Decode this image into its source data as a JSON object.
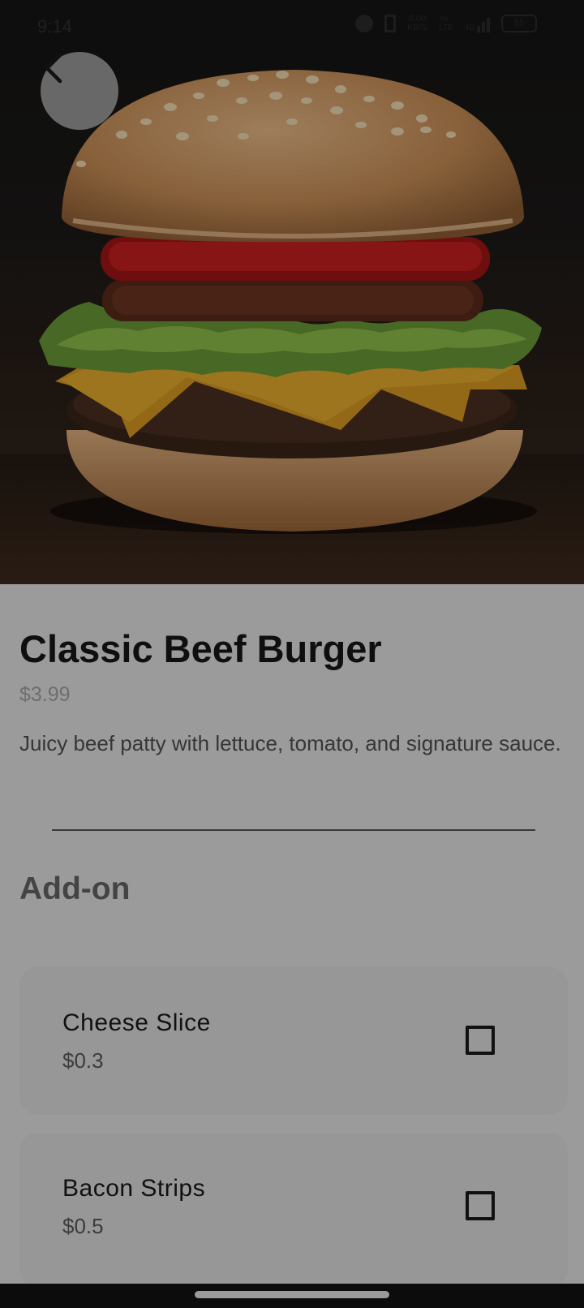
{
  "status_bar": {
    "time": "9:14",
    "speed_value": "0.00",
    "speed_unit": "KB/S",
    "volte_top": "Yo",
    "volte_bottom": "LTE",
    "network": "4G",
    "battery": "55"
  },
  "hero": {
    "image_subject": "burger-photo",
    "back_icon": "chevron-left-icon"
  },
  "product": {
    "title": "Classic Beef Burger",
    "price": "$3.99",
    "description": "Juicy beef patty with lettuce, tomato, and signature sauce."
  },
  "addons": {
    "heading": "Add-on",
    "items": [
      {
        "name": "Cheese Slice",
        "price": "$0.3",
        "checked": false
      },
      {
        "name": "Bacon Strips",
        "price": "$0.5",
        "checked": false
      }
    ]
  },
  "colors": {
    "content_bg": "#9b9b9b",
    "card_bg": "#979797",
    "title": "#0f0f0f"
  }
}
